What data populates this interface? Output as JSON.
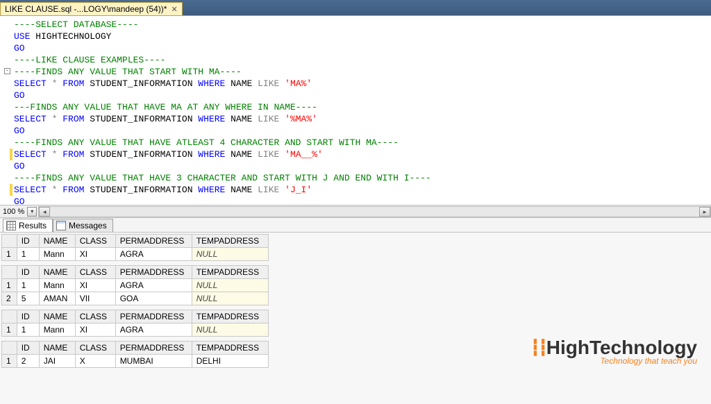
{
  "tab": {
    "title": "LIKE CLAUSE.sql -...LOGY\\mandeep (54))*"
  },
  "zoom": {
    "percent": "100 %"
  },
  "results_tabs": {
    "results": "Results",
    "messages": "Messages"
  },
  "editor_lines": [
    {
      "tokens": [
        {
          "t": "----SELECT DATABASE----",
          "c": "cmt"
        }
      ]
    },
    {
      "tokens": [
        {
          "t": "USE",
          "c": "kw-blue"
        },
        {
          "t": " HIGHTECHNOLOGY",
          "c": ""
        }
      ]
    },
    {
      "tokens": [
        {
          "t": "GO",
          "c": "kw-blue"
        }
      ]
    },
    {
      "tokens": [
        {
          "t": "",
          "c": ""
        }
      ]
    },
    {
      "minus": true,
      "tokens": [
        {
          "t": "----LIKE CLAUSE EXAMPLES----",
          "c": "cmt"
        }
      ]
    },
    {
      "tokens": [
        {
          "t": "----FINDS ANY VALUE THAT START WITH MA----",
          "c": "cmt"
        }
      ]
    },
    {
      "tokens": [
        {
          "t": "SELECT",
          "c": "kw-blue"
        },
        {
          "t": " ",
          "c": ""
        },
        {
          "t": "*",
          "c": "kw-gray"
        },
        {
          "t": " ",
          "c": ""
        },
        {
          "t": "FROM",
          "c": "kw-blue"
        },
        {
          "t": " STUDENT_INFORMATION ",
          "c": ""
        },
        {
          "t": "WHERE",
          "c": "kw-blue"
        },
        {
          "t": " NAME ",
          "c": ""
        },
        {
          "t": "LIKE",
          "c": "kw-gray"
        },
        {
          "t": " ",
          "c": ""
        },
        {
          "t": "'MA%'",
          "c": "str"
        }
      ]
    },
    {
      "tokens": [
        {
          "t": "GO",
          "c": "kw-blue"
        }
      ]
    },
    {
      "tokens": [
        {
          "t": "---FINDS ANY VALUE THAT HAVE MA AT ANY WHERE IN NAME----",
          "c": "cmt"
        }
      ]
    },
    {
      "tokens": [
        {
          "t": "SELECT",
          "c": "kw-blue"
        },
        {
          "t": " ",
          "c": ""
        },
        {
          "t": "*",
          "c": "kw-gray"
        },
        {
          "t": " ",
          "c": ""
        },
        {
          "t": "FROM",
          "c": "kw-blue"
        },
        {
          "t": " STUDENT_INFORMATION ",
          "c": ""
        },
        {
          "t": "WHERE",
          "c": "kw-blue"
        },
        {
          "t": " NAME ",
          "c": ""
        },
        {
          "t": "LIKE",
          "c": "kw-gray"
        },
        {
          "t": " ",
          "c": ""
        },
        {
          "t": "'%MA%'",
          "c": "str"
        }
      ]
    },
    {
      "tokens": [
        {
          "t": "GO",
          "c": "kw-blue"
        }
      ]
    },
    {
      "ybar": true,
      "tokens": [
        {
          "t": "----FINDS ANY VALUE THAT HAVE ATLEAST 4 CHARACTER AND START WITH MA----",
          "c": "cmt"
        }
      ]
    },
    {
      "tokens": [
        {
          "t": "SELECT",
          "c": "kw-blue"
        },
        {
          "t": " ",
          "c": ""
        },
        {
          "t": "*",
          "c": "kw-gray"
        },
        {
          "t": " ",
          "c": ""
        },
        {
          "t": "FROM",
          "c": "kw-blue"
        },
        {
          "t": " STUDENT_INFORMATION ",
          "c": ""
        },
        {
          "t": "WHERE",
          "c": "kw-blue"
        },
        {
          "t": " NAME ",
          "c": ""
        },
        {
          "t": "LIKE",
          "c": "kw-gray"
        },
        {
          "t": " ",
          "c": ""
        },
        {
          "t": "'MA__%'",
          "c": "str"
        }
      ]
    },
    {
      "tokens": [
        {
          "t": "GO",
          "c": "kw-blue"
        }
      ]
    },
    {
      "ybar": true,
      "tokens": [
        {
          "t": "----FINDS ANY VALUE THAT HAVE 3 CHARACTER AND START WITH J AND END WITH I----",
          "c": "cmt"
        }
      ]
    },
    {
      "tokens": [
        {
          "t": "SELECT",
          "c": "kw-blue"
        },
        {
          "t": " ",
          "c": ""
        },
        {
          "t": "*",
          "c": "kw-gray"
        },
        {
          "t": " ",
          "c": ""
        },
        {
          "t": "FROM",
          "c": "kw-blue"
        },
        {
          "t": " STUDENT_INFORMATION ",
          "c": ""
        },
        {
          "t": "WHERE",
          "c": "kw-blue"
        },
        {
          "t": " NAME ",
          "c": ""
        },
        {
          "t": "LIKE",
          "c": "kw-gray"
        },
        {
          "t": " ",
          "c": ""
        },
        {
          "t": "'J_I'",
          "c": "str"
        }
      ]
    },
    {
      "tokens": [
        {
          "t": "GO",
          "c": "kw-blue"
        }
      ]
    }
  ],
  "columns": [
    "ID",
    "NAME",
    "CLASS",
    "PERMADDRESS",
    "TEMPADDRESS"
  ],
  "grids": [
    {
      "rows": [
        {
          "n": "1",
          "cells": [
            "1",
            "Mann",
            "XI",
            "AGRA",
            null
          ]
        }
      ]
    },
    {
      "rows": [
        {
          "n": "1",
          "cells": [
            "1",
            "Mann",
            "XI",
            "AGRA",
            null
          ]
        },
        {
          "n": "2",
          "cells": [
            "5",
            "AMAN",
            "VII",
            "GOA",
            null
          ]
        }
      ]
    },
    {
      "rows": [
        {
          "n": "1",
          "cells": [
            "1",
            "Mann",
            "XI",
            "AGRA",
            null
          ]
        }
      ]
    },
    {
      "rows": [
        {
          "n": "1",
          "cells": [
            "2",
            "JAI",
            "X",
            "MUMBAI",
            "DELHI"
          ]
        }
      ]
    }
  ],
  "null_text": "NULL",
  "watermark": {
    "brand": "HighTechnology",
    "tagline": "Technology that teach you"
  }
}
